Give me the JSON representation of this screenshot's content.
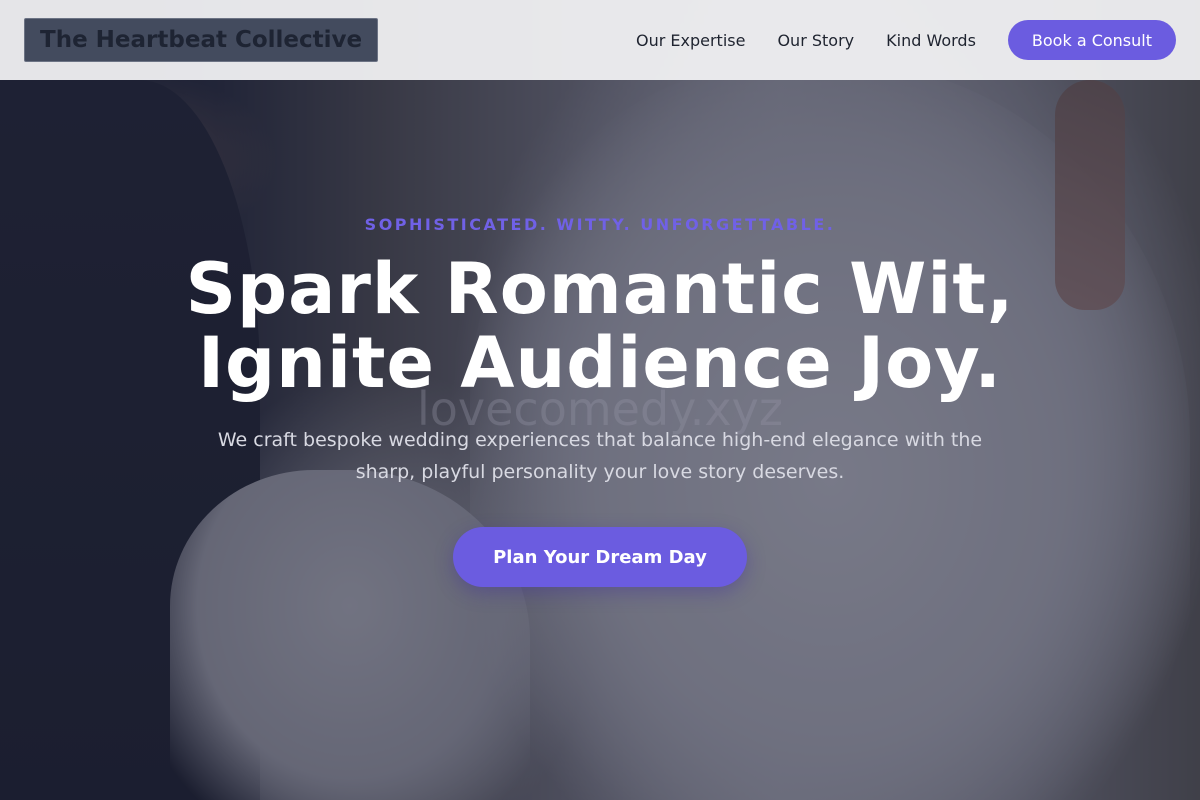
{
  "header": {
    "brand": "The Heartbeat Collective",
    "nav": [
      {
        "label": "Our Expertise"
      },
      {
        "label": "Our Story"
      },
      {
        "label": "Kind Words"
      }
    ],
    "cta_label": "Book a Consult"
  },
  "hero": {
    "eyebrow": "SOPHISTICATED. WITTY. UNFORGETTABLE.",
    "headline_line1": "Spark Romantic Wit,",
    "headline_line2": "Ignite Audience Joy.",
    "watermark": "lovecomedy.xyz",
    "subtext": "We craft bespoke wedding experiences that balance high-end elegance with the sharp, playful personality your love story deserves.",
    "cta_label": "Plan Your Dream Day",
    "background_image": "wedding-couple-photo"
  },
  "colors": {
    "accent": "#6b5ce0",
    "eyebrow": "#7061e6",
    "header_bg": "#f0f0f2",
    "brand_bg": "#434b5e",
    "headline": "#ffffff"
  }
}
